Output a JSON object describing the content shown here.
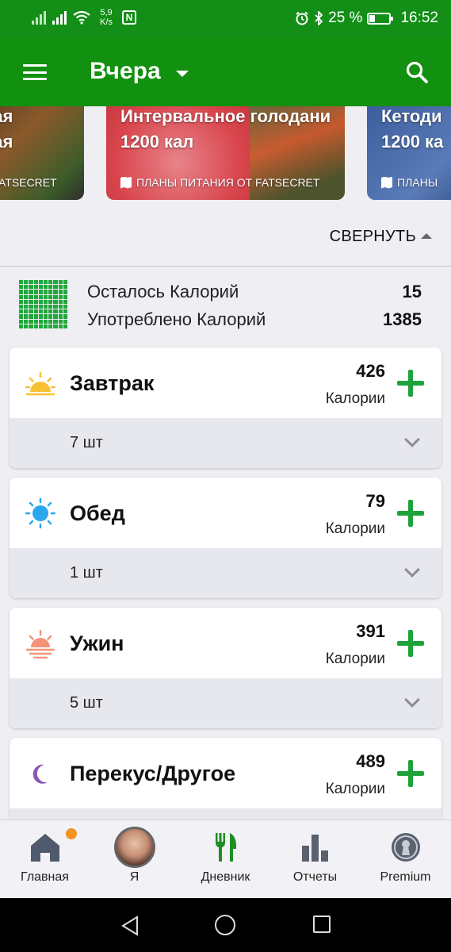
{
  "status_bar": {
    "net_speed_value": "5,9",
    "net_speed_unit": "K/s",
    "nfc_label": "N",
    "battery_percent": "25 %",
    "time": "16:52"
  },
  "app_bar": {
    "title": "Вчера",
    "icons": [
      "menu-icon",
      "dropdown-caret-icon",
      "search-icon"
    ]
  },
  "carousel": [
    {
      "line1": "вая",
      "line2": "ная",
      "source": "T FATSECRET"
    },
    {
      "line1": "Интервальное голодани",
      "line2": "1200 кал",
      "source": "ПЛАНЫ ПИТАНИЯ ОТ FATSECRET"
    },
    {
      "line1": "Кетоди",
      "line2": "1200 ка",
      "source": "ПЛАНЫ"
    }
  ],
  "collapse_label": "СВЕРНУТЬ",
  "summary": {
    "remaining_label": "Осталось Калорий",
    "remaining_value": "15",
    "consumed_label": "Употреблено Калорий",
    "consumed_value": "1385"
  },
  "meals": [
    {
      "name": "Завтрак",
      "calories": "426",
      "calories_label": "Калории",
      "count": "7 шт",
      "icon": "sunrise-icon"
    },
    {
      "name": "Обед",
      "calories": "79",
      "calories_label": "Калории",
      "count": "1 шт",
      "icon": "sun-icon"
    },
    {
      "name": "Ужин",
      "calories": "391",
      "calories_label": "Калории",
      "count": "5 шт",
      "icon": "sunset-icon"
    },
    {
      "name": "Перекус/Другое",
      "calories": "489",
      "calories_label": "Калории",
      "count": "",
      "icon": "moon-icon"
    }
  ],
  "bottom_nav": [
    {
      "label": "Главная",
      "icon": "home-icon"
    },
    {
      "label": "Я",
      "icon": "avatar"
    },
    {
      "label": "Дневник",
      "icon": "cutlery-icon"
    },
    {
      "label": "Отчеты",
      "icon": "bar-chart-icon"
    },
    {
      "label": "Premium",
      "icon": "premium-badge-icon"
    }
  ],
  "colors": {
    "primary_green": "#12900f",
    "accent_green": "#1ea33a",
    "notification_orange": "#f39322"
  }
}
